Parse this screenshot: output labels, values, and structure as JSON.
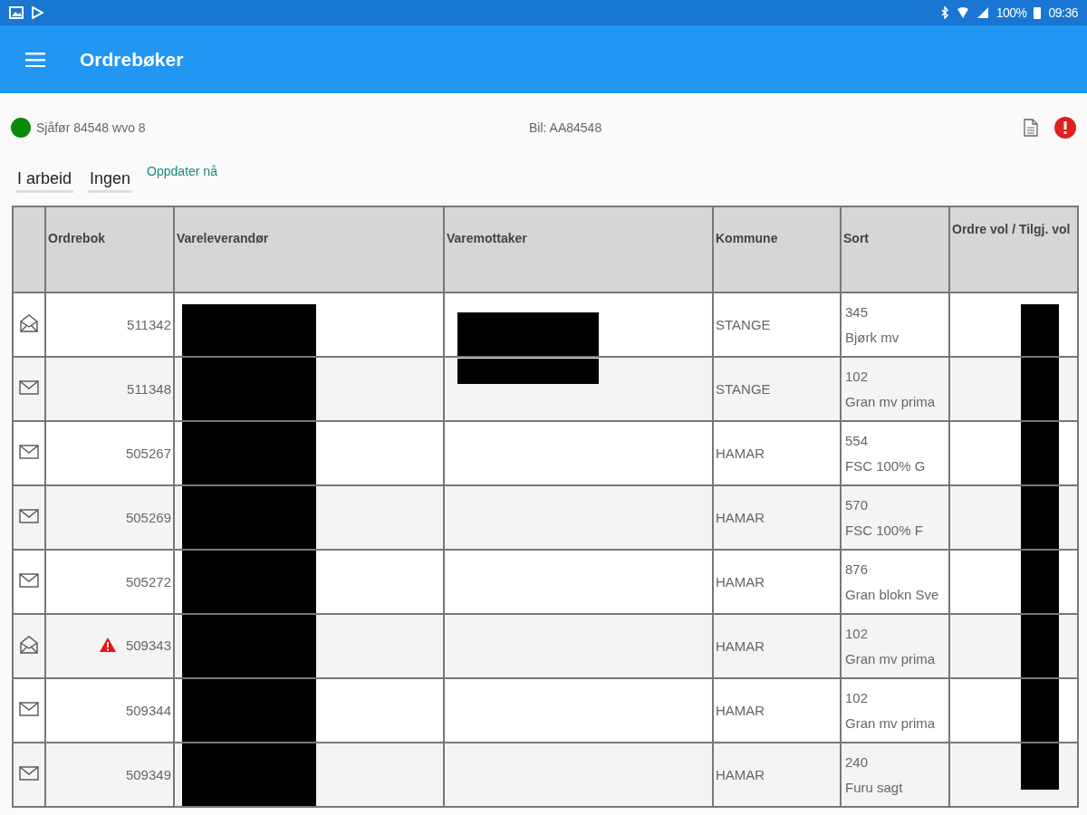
{
  "status_bar": {
    "battery": "100%",
    "time": "09:36"
  },
  "app_bar": {
    "title": "Ordrebøker"
  },
  "driver": {
    "online": true,
    "label": "Sjåfør 84548 wvo 8"
  },
  "vehicle": "Bil: AA84548",
  "filters": [
    {
      "value": "I arbeid"
    },
    {
      "value": "Ingen"
    }
  ],
  "refresh_link": "Oppdater nå",
  "table": {
    "columns": [
      "Ordrebok",
      "Vareleverandør",
      "Varemottaker",
      "Kommune",
      "Sort",
      "Ordre vol / Tilgj. vol"
    ],
    "rows": [
      {
        "opened": true,
        "warning": false,
        "ordrebok": "511342",
        "supplier_redacted": true,
        "receiver_redacted": true,
        "kommune": "STANGE",
        "sort_code": "345",
        "sort_name": "Bjørk mv",
        "volume_redacted": true
      },
      {
        "opened": false,
        "warning": false,
        "ordrebok": "511348",
        "supplier_redacted": true,
        "receiver_redacted": true,
        "kommune": "STANGE",
        "sort_code": "102",
        "sort_name": "Gran mv prima",
        "volume_redacted": true
      },
      {
        "opened": false,
        "warning": false,
        "ordrebok": "505267",
        "supplier_redacted": true,
        "receiver_redacted": false,
        "kommune": "HAMAR",
        "sort_code": "554",
        "sort_name": "FSC 100% G",
        "volume_redacted": true
      },
      {
        "opened": false,
        "warning": false,
        "ordrebok": "505269",
        "supplier_redacted": true,
        "receiver_redacted": false,
        "kommune": "HAMAR",
        "sort_code": "570",
        "sort_name": "FSC 100% F",
        "volume_redacted": true
      },
      {
        "opened": false,
        "warning": false,
        "ordrebok": "505272",
        "supplier_redacted": true,
        "receiver_redacted": false,
        "kommune": "HAMAR",
        "sort_code": "876",
        "sort_name": "Gran blokn Sve",
        "volume_redacted": true
      },
      {
        "opened": true,
        "warning": true,
        "ordrebok": "509343",
        "supplier_redacted": true,
        "receiver_redacted": false,
        "kommune": "HAMAR",
        "sort_code": "102",
        "sort_name": "Gran mv prima",
        "volume_redacted": true
      },
      {
        "opened": false,
        "warning": false,
        "ordrebok": "509344",
        "supplier_redacted": true,
        "receiver_redacted": false,
        "kommune": "HAMAR",
        "sort_code": "102",
        "sort_name": "Gran mv prima",
        "volume_redacted": true
      },
      {
        "opened": false,
        "warning": false,
        "ordrebok": "509349",
        "supplier_redacted": true,
        "receiver_redacted": false,
        "kommune": "HAMAR",
        "sort_code": "240",
        "sort_name": "Furu sagt",
        "volume_redacted": true
      }
    ]
  }
}
